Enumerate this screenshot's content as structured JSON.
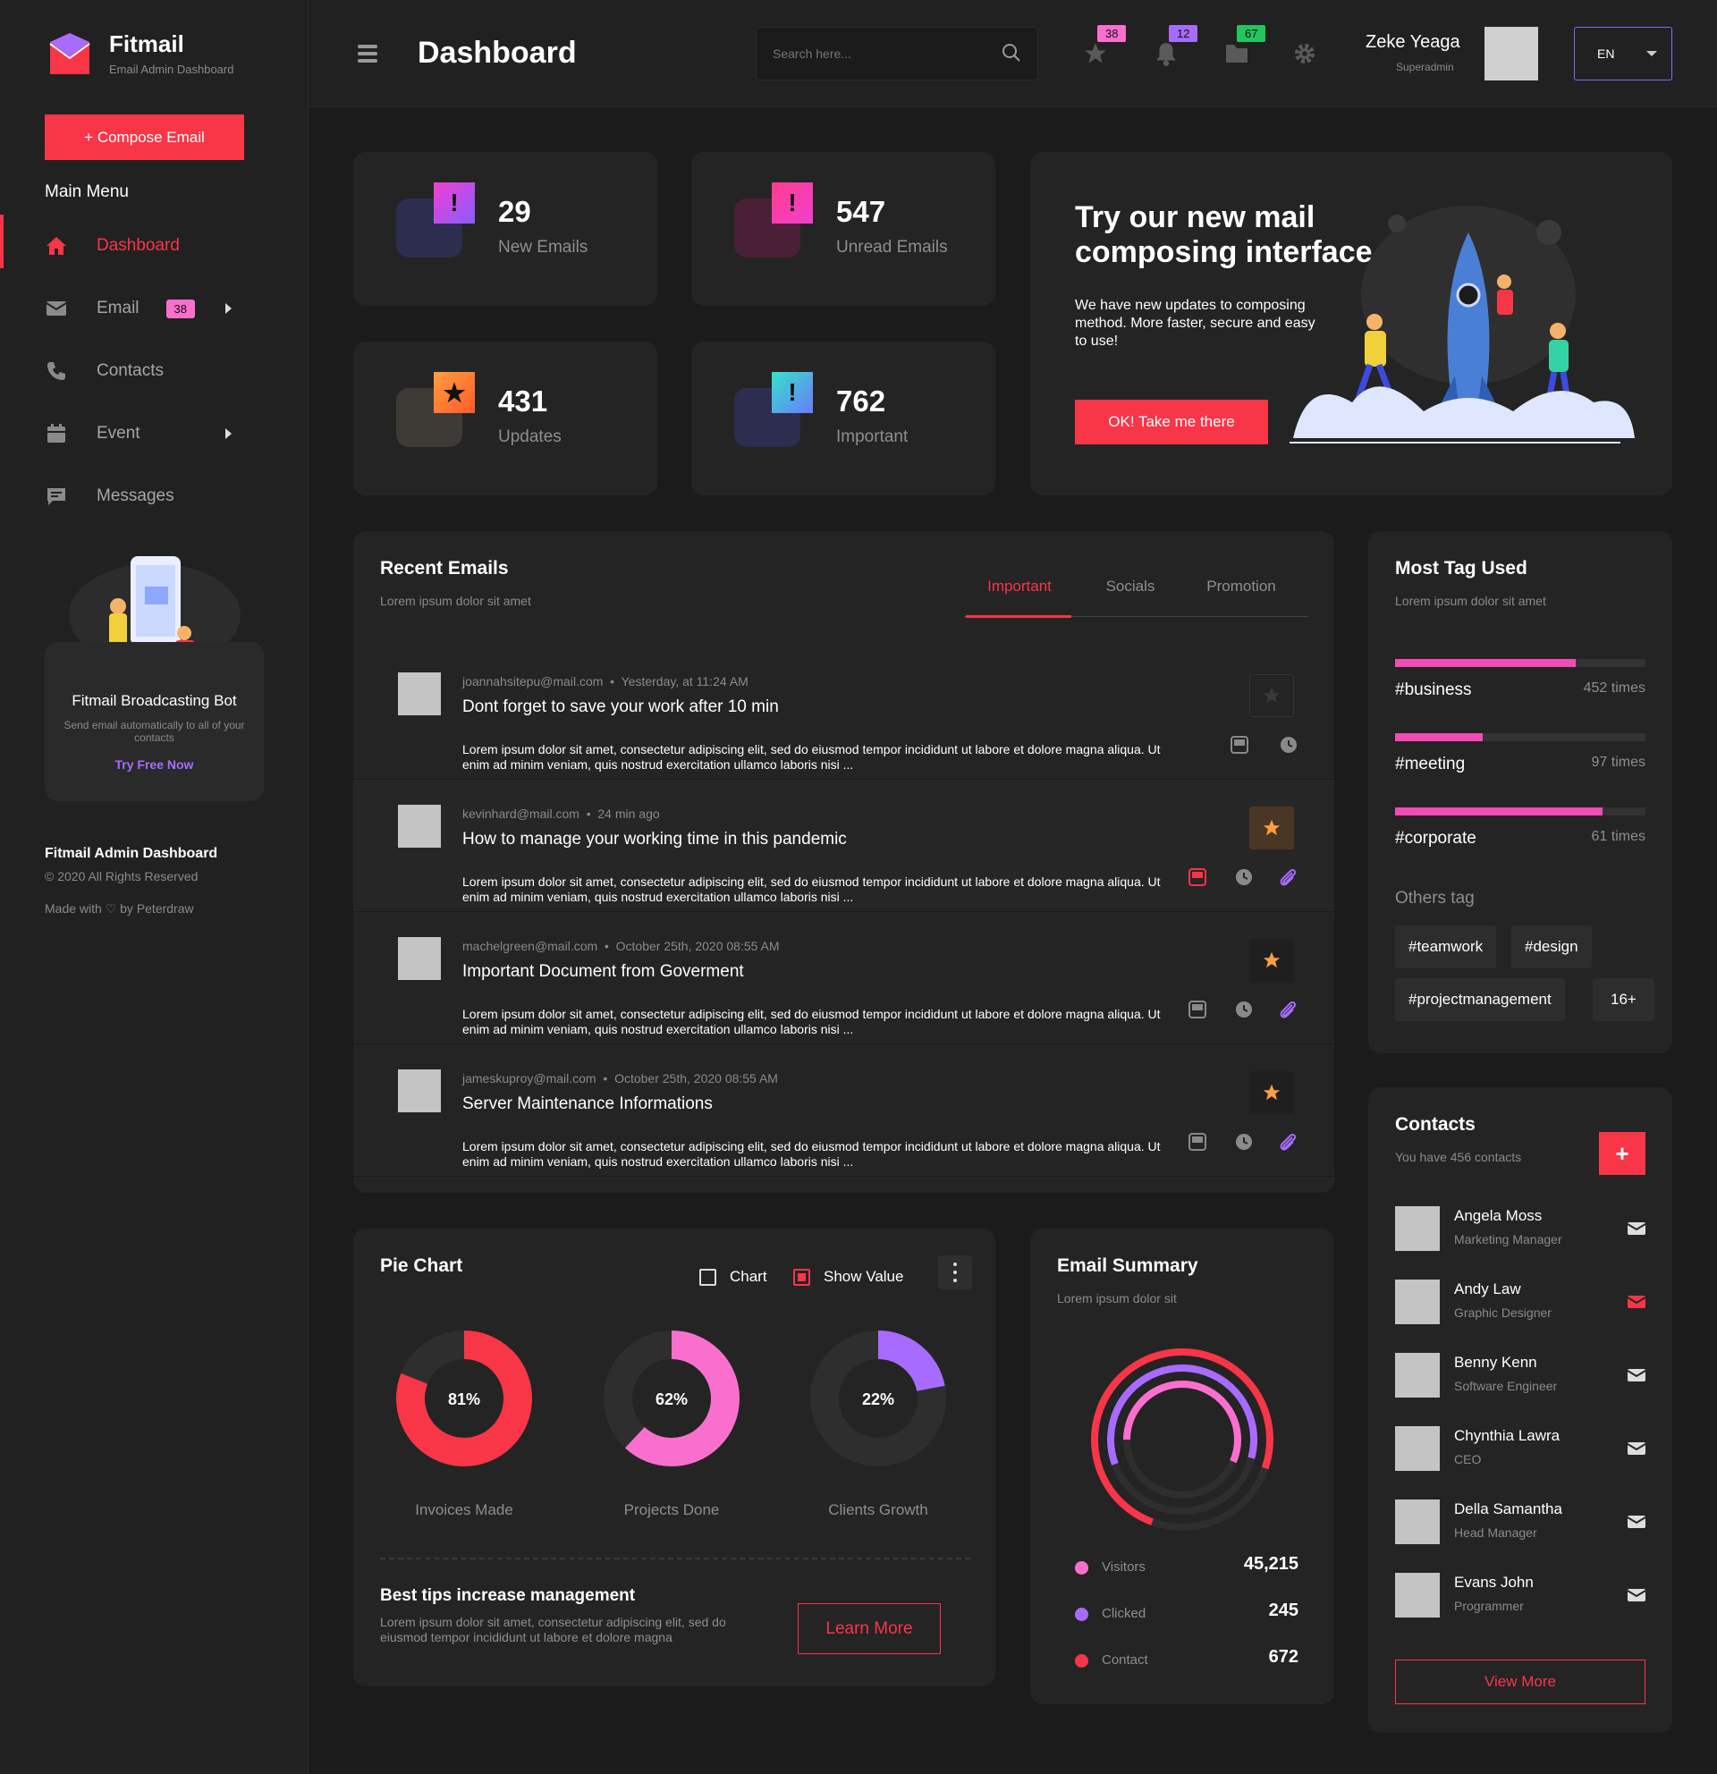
{
  "brand": {
    "name": "Fitmail",
    "sub": "Email Admin Dashboard"
  },
  "sidebar": {
    "compose": "+ Compose Email",
    "menu_title": "Main Menu",
    "items": [
      {
        "label": "Dashboard",
        "icon": "home-icon"
      },
      {
        "label": "Email",
        "icon": "mail-icon",
        "badge": "38"
      },
      {
        "label": "Contacts",
        "icon": "phone-icon"
      },
      {
        "label": "Event",
        "icon": "calendar-icon"
      },
      {
        "label": "Messages",
        "icon": "chat-icon"
      }
    ],
    "bot": {
      "title": "Fitmail Broadcasting Bot",
      "sub": "Send email automatically to all of your contacts",
      "link": "Try Free Now"
    },
    "footer": {
      "title": "Fitmail Admin Dashboard",
      "copy": "© 2020 All Rights Reserved",
      "made": "Made with ♡ by Peterdraw"
    }
  },
  "header": {
    "title": "Dashboard",
    "search_placeholder": "Search here...",
    "badges": {
      "star": "38",
      "bell": "12",
      "folder": "67"
    },
    "user": {
      "name": "Zeke Yeaga",
      "role": "Superadmin"
    },
    "lang": "EN"
  },
  "stats": [
    {
      "num": "29",
      "label": "New Emails"
    },
    {
      "num": "547",
      "label": "Unread Emails"
    },
    {
      "num": "431",
      "label": "Updates"
    },
    {
      "num": "762",
      "label": "Important"
    }
  ],
  "promo": {
    "title": "Try our new mail composing interface",
    "sub": "We have new updates to composing method. More faster, secure and easy to use!",
    "button": "OK! Take me there"
  },
  "recent": {
    "title": "Recent Emails",
    "sub": "Lorem ipsum dolor sit amet",
    "tabs": [
      "Important",
      "Socials",
      "Promotion"
    ],
    "emails": [
      {
        "from": "joannahsitepu@mail.com",
        "time": "Yesterday, at 11:24 AM",
        "subject": "Dont forget to save your work after 10 min",
        "body": "Lorem ipsum dolor sit amet, consectetur adipiscing elit, sed do eiusmod tempor incididunt ut labore et dolore magna aliqua. Ut enim ad minim veniam, quis nostrud exercitation ullamco laboris nisi ..."
      },
      {
        "from": "kevinhard@mail.com",
        "time": "24 min ago",
        "subject": "How to manage your working time in this pandemic",
        "body": "Lorem ipsum dolor sit amet, consectetur adipiscing elit, sed do eiusmod tempor incididunt ut labore et dolore magna aliqua. Ut enim ad minim veniam, quis nostrud exercitation ullamco laboris nisi ..."
      },
      {
        "from": "machelgreen@mail.com",
        "time": "October 25th, 2020  08:55 AM",
        "subject": "Important Document from Goverment",
        "body": "Lorem ipsum dolor sit amet, consectetur adipiscing elit, sed do eiusmod tempor incididunt ut labore et dolore magna aliqua. Ut enim ad minim veniam, quis nostrud exercitation ullamco laboris nisi ..."
      },
      {
        "from": "jameskuproy@mail.com",
        "time": "October 25th, 2020  08:55 AM",
        "subject": "Server Maintenance Informations",
        "body": "Lorem ipsum dolor sit amet, consectetur adipiscing elit, sed do eiusmod tempor incididunt ut labore et dolore magna aliqua. Ut enim ad minim veniam, quis nostrud exercitation ullamco laboris nisi ..."
      }
    ]
  },
  "tags": {
    "title": "Most Tag Used",
    "sub": "Lorem ipsum dolor sit amet",
    "items": [
      {
        "name": "#business",
        "count": "452 times",
        "level": 0.72
      },
      {
        "name": "#meeting",
        "count": "97 times",
        "level": 0.35
      },
      {
        "name": "#corporate",
        "count": "61 times",
        "level": 0.83
      }
    ],
    "others_title": "Others tag",
    "others": [
      "#teamwork",
      "#design",
      "#projectmanagement",
      "16+"
    ]
  },
  "contacts": {
    "title": "Contacts",
    "sub": "You have 456 contacts",
    "add": "+",
    "items": [
      {
        "name": "Angela Moss",
        "role": "Marketing Manager"
      },
      {
        "name": "Andy Law",
        "role": "Graphic Designer"
      },
      {
        "name": "Benny Kenn",
        "role": "Software Engineer"
      },
      {
        "name": "Chynthia Lawra",
        "role": "CEO"
      },
      {
        "name": "Della Samantha",
        "role": "Head Manager"
      },
      {
        "name": "Evans John",
        "role": "Programmer"
      }
    ],
    "view_more": "View More"
  },
  "pie": {
    "title": "Pie Chart",
    "check_chart": "Chart",
    "check_value": "Show Value",
    "tips_title": "Best tips increase management",
    "tips_sub": "Lorem ipsum dolor sit amet, consectetur adipiscing elit, sed do eiusmod tempor incididunt ut labore et dolore magna",
    "learn": "Learn More"
  },
  "summary": {
    "title": "Email Summary",
    "sub": "Lorem ipsum dolor sit",
    "legend": [
      {
        "name": "Visitors",
        "value": "45,215",
        "color": "#fa6fce"
      },
      {
        "name": "Clicked",
        "value": "245",
        "color": "#a86bff"
      },
      {
        "name": "Contact",
        "value": "672",
        "color": "#f93548"
      }
    ]
  },
  "chart_data": {
    "type": "pie",
    "categories": [
      "Invoices Made",
      "Projects Done",
      "Clients Growth"
    ],
    "values": [
      81,
      62,
      22
    ],
    "value_labels": [
      "81%",
      "62%",
      "22%"
    ],
    "colors": [
      "#f93548",
      "#fa6fce",
      "#a86bff"
    ]
  }
}
